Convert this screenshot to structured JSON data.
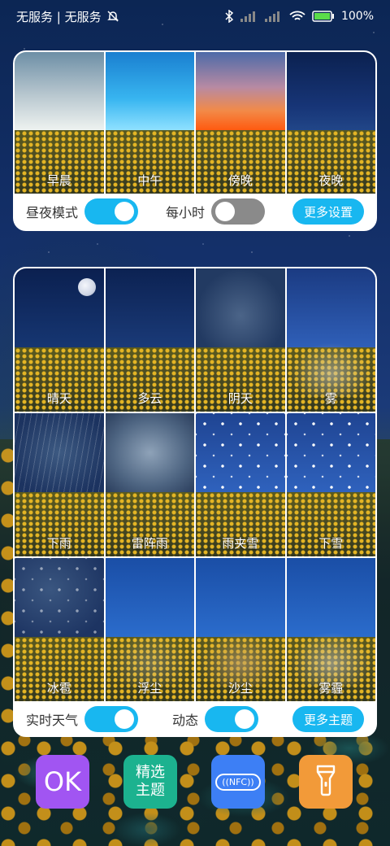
{
  "status_bar": {
    "carrier": "无服务 | 无服务",
    "battery": "100%"
  },
  "time_panel": {
    "tiles": [
      {
        "label": "早晨"
      },
      {
        "label": "中午"
      },
      {
        "label": "傍晚"
      },
      {
        "label": "夜晚"
      }
    ],
    "day_night_label": "昼夜模式",
    "day_night_on": true,
    "hourly_label": "每小时",
    "hourly_on": false,
    "more_settings": "更多设置"
  },
  "weather_panel": {
    "tiles": [
      {
        "label": "晴天"
      },
      {
        "label": "多云"
      },
      {
        "label": "阴天"
      },
      {
        "label": "雾"
      },
      {
        "label": "下雨"
      },
      {
        "label": "雷阵雨"
      },
      {
        "label": "雨夹雪"
      },
      {
        "label": "下雪"
      },
      {
        "label": "冰雹"
      },
      {
        "label": "浮尘"
      },
      {
        "label": "沙尘"
      },
      {
        "label": "雾霾"
      }
    ],
    "realtime_label": "实时天气",
    "realtime_on": true,
    "dynamic_label": "动态",
    "dynamic_on": true,
    "more_themes": "更多主题"
  },
  "dock": {
    "ok_label": "OK",
    "theme_line1": "精选",
    "theme_line2": "主题",
    "nfc_label": "NFC",
    "icons": [
      "ok-icon",
      "theme-icon",
      "nfc-icon",
      "flashlight-icon"
    ]
  }
}
